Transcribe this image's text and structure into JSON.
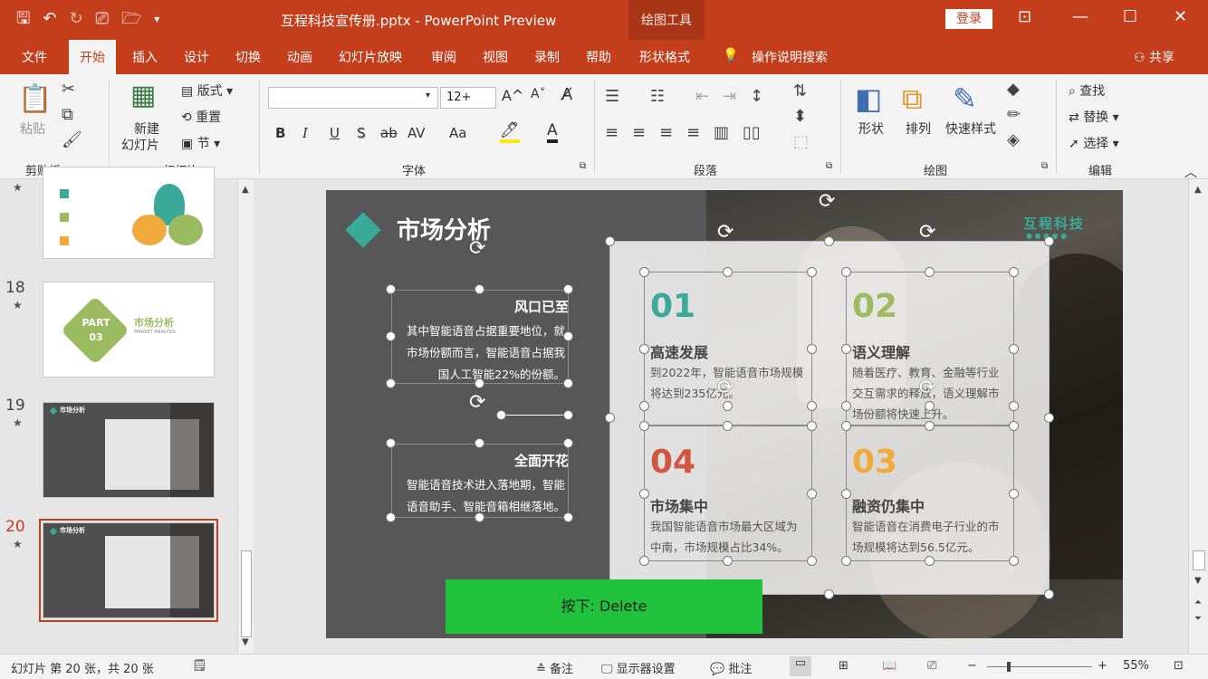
{
  "window": {
    "doc_title": "互程科技宣传册.pptx  -  PowerPoint Preview",
    "context_tool": "绘图工具",
    "login": "登录",
    "share": "共享"
  },
  "tabs": [
    "文件",
    "开始",
    "插入",
    "设计",
    "切换",
    "动画",
    "幻灯片放映",
    "审阅",
    "视图",
    "录制",
    "帮助",
    "形状格式",
    "操作说明搜索"
  ],
  "ribbon": {
    "groups": [
      "剪贴板",
      "幻灯片",
      "字体",
      "段落",
      "绘图",
      "编辑"
    ],
    "paste": "粘贴",
    "new_slide_1": "新建",
    "new_slide_2": "幻灯片",
    "layout": "版式",
    "reset": "重置",
    "section": "节",
    "font_name": "",
    "font_size": "12+",
    "bold": "B",
    "italic": "I",
    "underline": "U",
    "shadow": "S",
    "strike": "ab",
    "spacing": "AV",
    "case": "Aa",
    "shape": "形状",
    "arrange": "排列",
    "quick_style": "快速样式",
    "find": "查找",
    "replace": "替换",
    "select": "选择"
  },
  "thumbnails": [
    {
      "num": "",
      "star": "★"
    },
    {
      "num": "18",
      "star": "★",
      "part": "PART",
      "part_num": "03",
      "part_title": "市场分析",
      "part_sub": "MARKET ANALYSIS"
    },
    {
      "num": "19",
      "star": "★",
      "title": "市场分析"
    },
    {
      "num": "20",
      "star": "★",
      "title": "市场分析"
    }
  ],
  "slide": {
    "title": "市场分析",
    "brand": "互程科技",
    "left": [
      {
        "heading": "风口已至",
        "text": "其中智能语音占据重要地位，就市场份额而言，智能语音占据我国人工智能22%的份额。"
      },
      {
        "heading": "全面开花",
        "text": "智能语音技术进入落地期，智能语音助手、智能音箱相继落地。"
      }
    ],
    "cards": [
      {
        "num": "01",
        "heading": "高速发展",
        "text": "到2022年，智能语音市场规模将达到235亿元。"
      },
      {
        "num": "02",
        "heading": "语义理解",
        "text": "随着医疗、教育、金融等行业交互需求的释放，语义理解市场份额将快速上升。"
      },
      {
        "num": "04",
        "heading": "市场集中",
        "text": "我国智能语音市场最大区域为中南，市场规模占比34%。"
      },
      {
        "num": "03",
        "heading": "融资仍集中",
        "text": "智能语音在消费电子行业的市场规模将达到56.5亿元。"
      }
    ],
    "key_hint": "按下:  Delete"
  },
  "colors": {
    "teal": "#3aa99a",
    "green": "#9cba5f",
    "red": "#d2553f",
    "orange": "#f0a93b",
    "accent": "#c43e1c"
  },
  "status": {
    "slide_info": "幻灯片 第 20 张，共 20 张",
    "notes": "备注",
    "display": "显示器设置",
    "comments": "批注",
    "zoom": "55%"
  }
}
